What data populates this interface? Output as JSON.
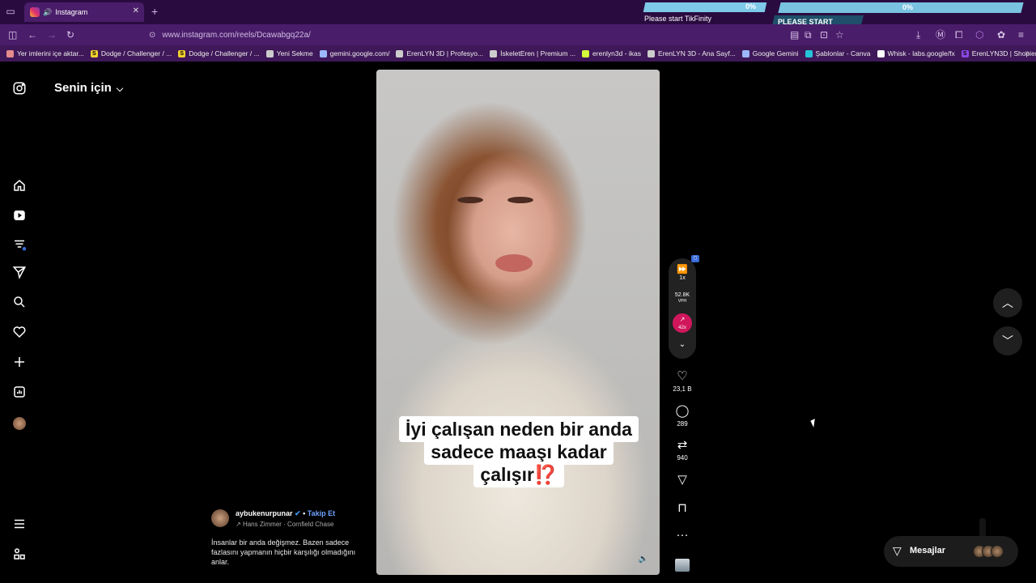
{
  "browser": {
    "tab_title": "Instagram",
    "url": "www.instagram.com/reels/Dcawabgq22a/",
    "bookmarks": [
      {
        "label": "Yer imlerini içe aktar...",
        "icon": "import-icon",
        "color": "#e58b8b"
      },
      {
        "label": "Dodge / Challenger / ...",
        "icon": "S",
        "color": "#f2d22e"
      },
      {
        "label": "Dodge / Challenger / ...",
        "icon": "S",
        "color": "#f2d22e"
      },
      {
        "label": "Yeni Sekme",
        "icon": "globe-icon",
        "color": "#cccccc"
      },
      {
        "label": "gemini.google.com/",
        "icon": "sparkle-icon",
        "color": "#9bb8ff"
      },
      {
        "label": "ErenLYN 3D | Profesyo...",
        "icon": "site-icon",
        "color": "#cccccc"
      },
      {
        "label": "İskeletEren | Premium ...",
        "icon": "site-icon",
        "color": "#cccccc"
      },
      {
        "label": "erenlyn3d - ikas",
        "icon": "bolt-icon",
        "color": "#d4ff3a"
      },
      {
        "label": "ErenLYN 3D - Ana Sayf...",
        "icon": "globe-icon",
        "color": "#cccccc"
      },
      {
        "label": "Google Gemini",
        "icon": "sparkle-icon",
        "color": "#9bb8ff"
      },
      {
        "label": "Şablonlar - Canva",
        "icon": "canva-icon",
        "color": "#24c4d8"
      },
      {
        "label": "Whisk - labs.google/fx",
        "icon": "page-icon",
        "color": "#ffffff"
      },
      {
        "label": "ErenLYN3D | Shopier",
        "icon": "S",
        "color": "#8b47e6"
      }
    ]
  },
  "overlay": {
    "left_percent": "0%",
    "left_label": "Please start TikFinity",
    "right_percent": "0%",
    "right_label": "PLEASE START TIKFINITY"
  },
  "feed": {
    "title": "Senin için"
  },
  "reel": {
    "caption_lines": [
      "İyi çalışan neden bir anda",
      "sadece maaşı kadar",
      "çalışır⁉️"
    ],
    "speed": "1x",
    "vph_value": "52.8K",
    "vph_label": "VPH",
    "trend_value": "42x",
    "likes": "23,1 B",
    "comments": "289",
    "reposts": "940",
    "author": "aybukenurpunar",
    "follow_label": "Takip Et",
    "music": "Hans Zimmer · Cornfield Chase",
    "description": "İnsanlar bir anda değişmez. Bazen sadece fazlasını yapmanın hiçbir karşılığı olmadığını anlar."
  },
  "messages": {
    "label": "Mesajlar"
  }
}
